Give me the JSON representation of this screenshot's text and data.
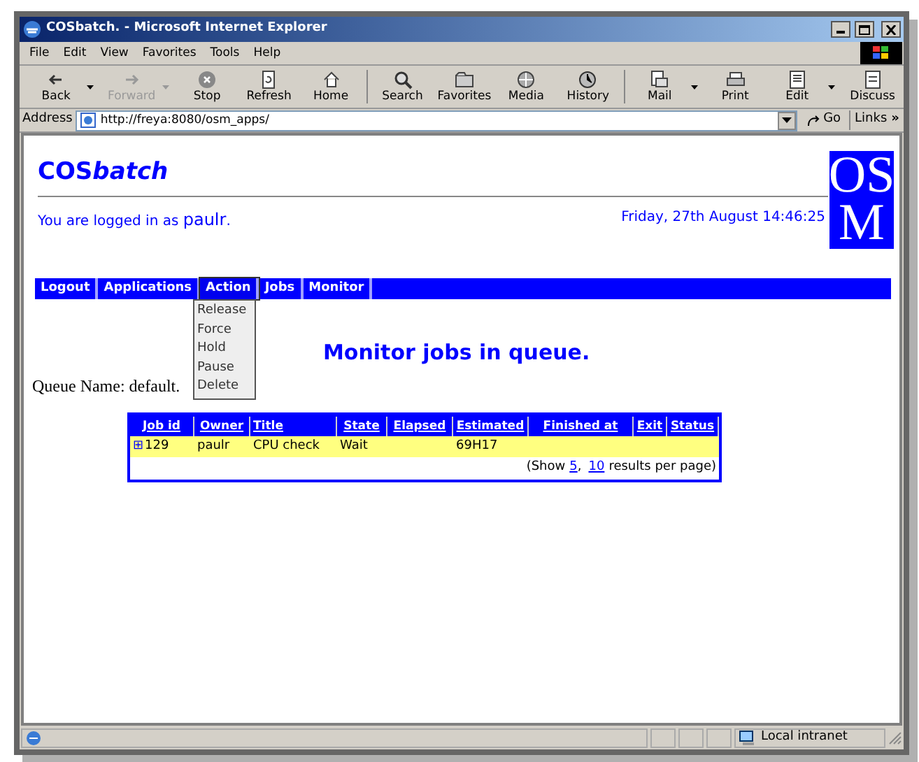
{
  "window": {
    "title": "COSbatch. - Microsoft Internet Explorer"
  },
  "menu": [
    "File",
    "Edit",
    "View",
    "Favorites",
    "Tools",
    "Help"
  ],
  "toolbar": [
    [
      {
        "label": "Back",
        "disabled": false,
        "dropdown": true
      },
      {
        "label": "Forward",
        "disabled": true,
        "dropdown": true
      },
      {
        "label": "Stop",
        "disabled": false,
        "dropdown": false
      },
      {
        "label": "Refresh",
        "disabled": false,
        "dropdown": false
      },
      {
        "label": "Home",
        "disabled": false,
        "dropdown": false
      }
    ],
    [
      {
        "label": "Search",
        "disabled": false,
        "dropdown": false
      },
      {
        "label": "Favorites",
        "disabled": false,
        "dropdown": false
      },
      {
        "label": "Media",
        "disabled": false,
        "dropdown": false
      },
      {
        "label": "History",
        "disabled": false,
        "dropdown": false
      }
    ],
    [
      {
        "label": "Mail",
        "disabled": false,
        "dropdown": true
      },
      {
        "label": "Print",
        "disabled": false,
        "dropdown": false
      },
      {
        "label": "Edit",
        "disabled": false,
        "dropdown": true
      },
      {
        "label": "Discuss",
        "disabled": false,
        "dropdown": false
      }
    ]
  ],
  "address": {
    "label": "Address",
    "url": "http://freya:8080/osm_apps/",
    "go": "Go",
    "links": "Links",
    "links_more": "»"
  },
  "page": {
    "brand": "COS",
    "brand_italic": "batch",
    "logged_in": "You are logged in as",
    "user": "paulr",
    "user_end": ".",
    "datetime": "Friday, 27th August 14:46:25",
    "logo": [
      "OS",
      "M"
    ],
    "nav": [
      {
        "label": "Logout",
        "open": false
      },
      {
        "label": "Applications",
        "open": false
      },
      {
        "label": "Action",
        "open": true
      },
      {
        "label": "Jobs",
        "open": false
      },
      {
        "label": "Monitor",
        "open": false
      }
    ],
    "action_menu": [
      "Release",
      "Force",
      "Hold",
      "Pause",
      "Delete"
    ],
    "heading": "Monitor jobs in queue.",
    "queue": "Queue Name: default.",
    "table": {
      "columns": [
        "Job id",
        "Owner",
        "Title",
        "State",
        "Elapsed",
        "Estimated",
        "Finished at",
        "Exit",
        "Status"
      ],
      "rows": [
        {
          "expand": "⊞",
          "cells": [
            "129",
            "paulr",
            "CPU check",
            "Wait",
            "",
            "69H17",
            "",
            "",
            ""
          ]
        }
      ],
      "pager": {
        "before": "(Show",
        "links": [
          "5",
          "10"
        ],
        "sep": ",",
        "after": "results per page)"
      }
    }
  },
  "status_bar": {
    "zone": "Local intranet"
  }
}
